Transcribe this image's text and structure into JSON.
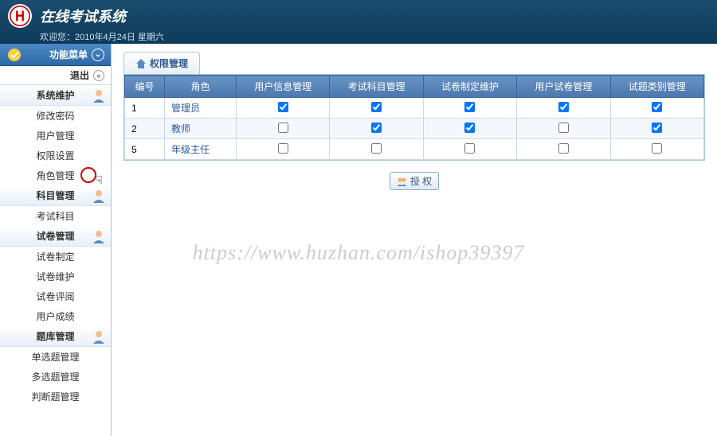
{
  "header": {
    "title": "在线考试系统",
    "welcome_prefix": "欢迎您：",
    "welcome_date": "2010年4月24日 星期六"
  },
  "sidebar": {
    "menu_title": "功能菜单",
    "exit_label": "退出",
    "groups": [
      {
        "title": "系统维护",
        "items": [
          "修改密码",
          "用户管理",
          "权限设置",
          "角色管理"
        ]
      },
      {
        "title": "科目管理",
        "items": [
          "考试科目"
        ]
      },
      {
        "title": "试卷管理",
        "items": [
          "试卷制定",
          "试卷维护",
          "试卷评阅",
          "用户成绩"
        ]
      },
      {
        "title": "题库管理",
        "items": [
          "单选题管理",
          "多选题管理",
          "判断题管理"
        ]
      }
    ]
  },
  "panel": {
    "title": "权限管理",
    "columns": [
      "编号",
      "角色",
      "用户信息管理",
      "考试科目管理",
      "试卷制定维护",
      "用户试卷管理",
      "试题类别管理"
    ],
    "rows": [
      {
        "id": "1",
        "role": "管理员",
        "perms": [
          true,
          true,
          true,
          true,
          true
        ]
      },
      {
        "id": "2",
        "role": "教师",
        "perms": [
          false,
          true,
          true,
          false,
          true
        ]
      },
      {
        "id": "5",
        "role": "年级主任",
        "perms": [
          false,
          false,
          false,
          false,
          false
        ]
      }
    ],
    "button_label": "授 权"
  },
  "watermark": "https://www.huzhan.com/ishop39397"
}
